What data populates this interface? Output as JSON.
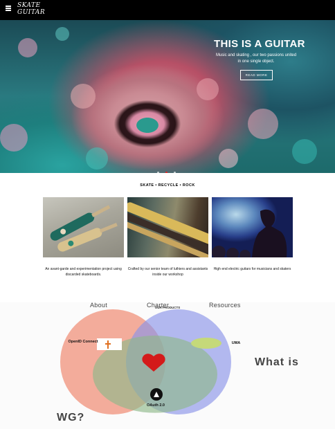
{
  "header": {
    "logo_line1": "SKATE",
    "logo_line2": "GUITAR"
  },
  "hero": {
    "title": "THIS IS A GUITAR",
    "subtitle": "Music and skating , our two passions united in one single object.",
    "button_label": "READ MORE",
    "slides": 3,
    "active_slide": 2
  },
  "tagline": "SKATE • RECYCLE • ROCK",
  "cards": [
    {
      "text": "An avant-garde and experimentation project using discarded skateboards."
    },
    {
      "text": "Crafted by our senior team of luthiers and assistants inside our workshop"
    },
    {
      "text": "High end electric guitars for musicians and skaters"
    }
  ],
  "nav": {
    "about": "About",
    "charter": "Charter",
    "resources": "Resources"
  },
  "products_label": "OUR PRODUCTS",
  "venn": {
    "openid": "OpenID Connect",
    "uma": "UMA",
    "oauth": "OAuth 2.0",
    "overlay_text": "What is",
    "overlay_text2": "WG?",
    "colors": {
      "red": "#f08a72",
      "blue": "#8a93e8",
      "green": "#8fb98a",
      "heart": "#d41a1a"
    }
  }
}
